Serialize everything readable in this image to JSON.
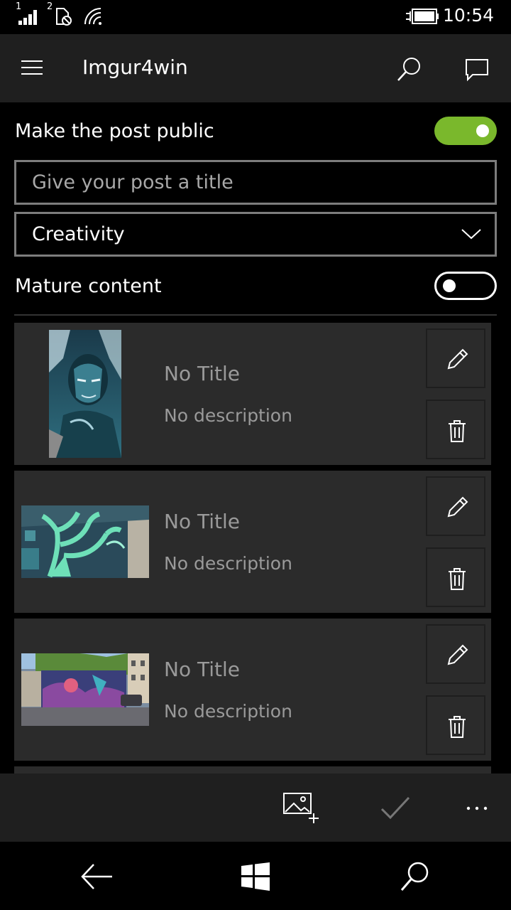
{
  "status_bar": {
    "time": "10:54",
    "icons": [
      "signal-bars-icon",
      "sim-blocked-icon",
      "wifi-icon",
      "battery-charging-icon"
    ],
    "sim1_label": "1",
    "sim2_label": "2"
  },
  "app_bar": {
    "title": "Imgur4win",
    "icons": [
      "hamburger-menu-icon",
      "search-icon",
      "comment-icon"
    ]
  },
  "form": {
    "public_label": "Make the post public",
    "public_on": true,
    "title_placeholder": "Give your post a title",
    "title_value": "",
    "topic_selected": "Creativity",
    "mature_label": "Mature content",
    "mature_on": false
  },
  "images": [
    {
      "title": "No Title",
      "description": "No description",
      "thumbnail": "portrait-mural-thumbnail"
    },
    {
      "title": "No Title",
      "description": "No description",
      "thumbnail": "tree-mural-thumbnail"
    },
    {
      "title": "No Title",
      "description": "No description",
      "thumbnail": "street-mural-thumbnail"
    }
  ],
  "command_bar": {
    "icons": [
      "add-image-icon",
      "checkmark-icon",
      "more-icon"
    ]
  },
  "nav_bar": {
    "icons": [
      "back-arrow-icon",
      "windows-start-icon",
      "search-icon"
    ]
  },
  "colors": {
    "accent": "#7ab82c",
    "app_bar": "#1f1f1f",
    "card": "#2b2b2b",
    "background": "#000000"
  }
}
